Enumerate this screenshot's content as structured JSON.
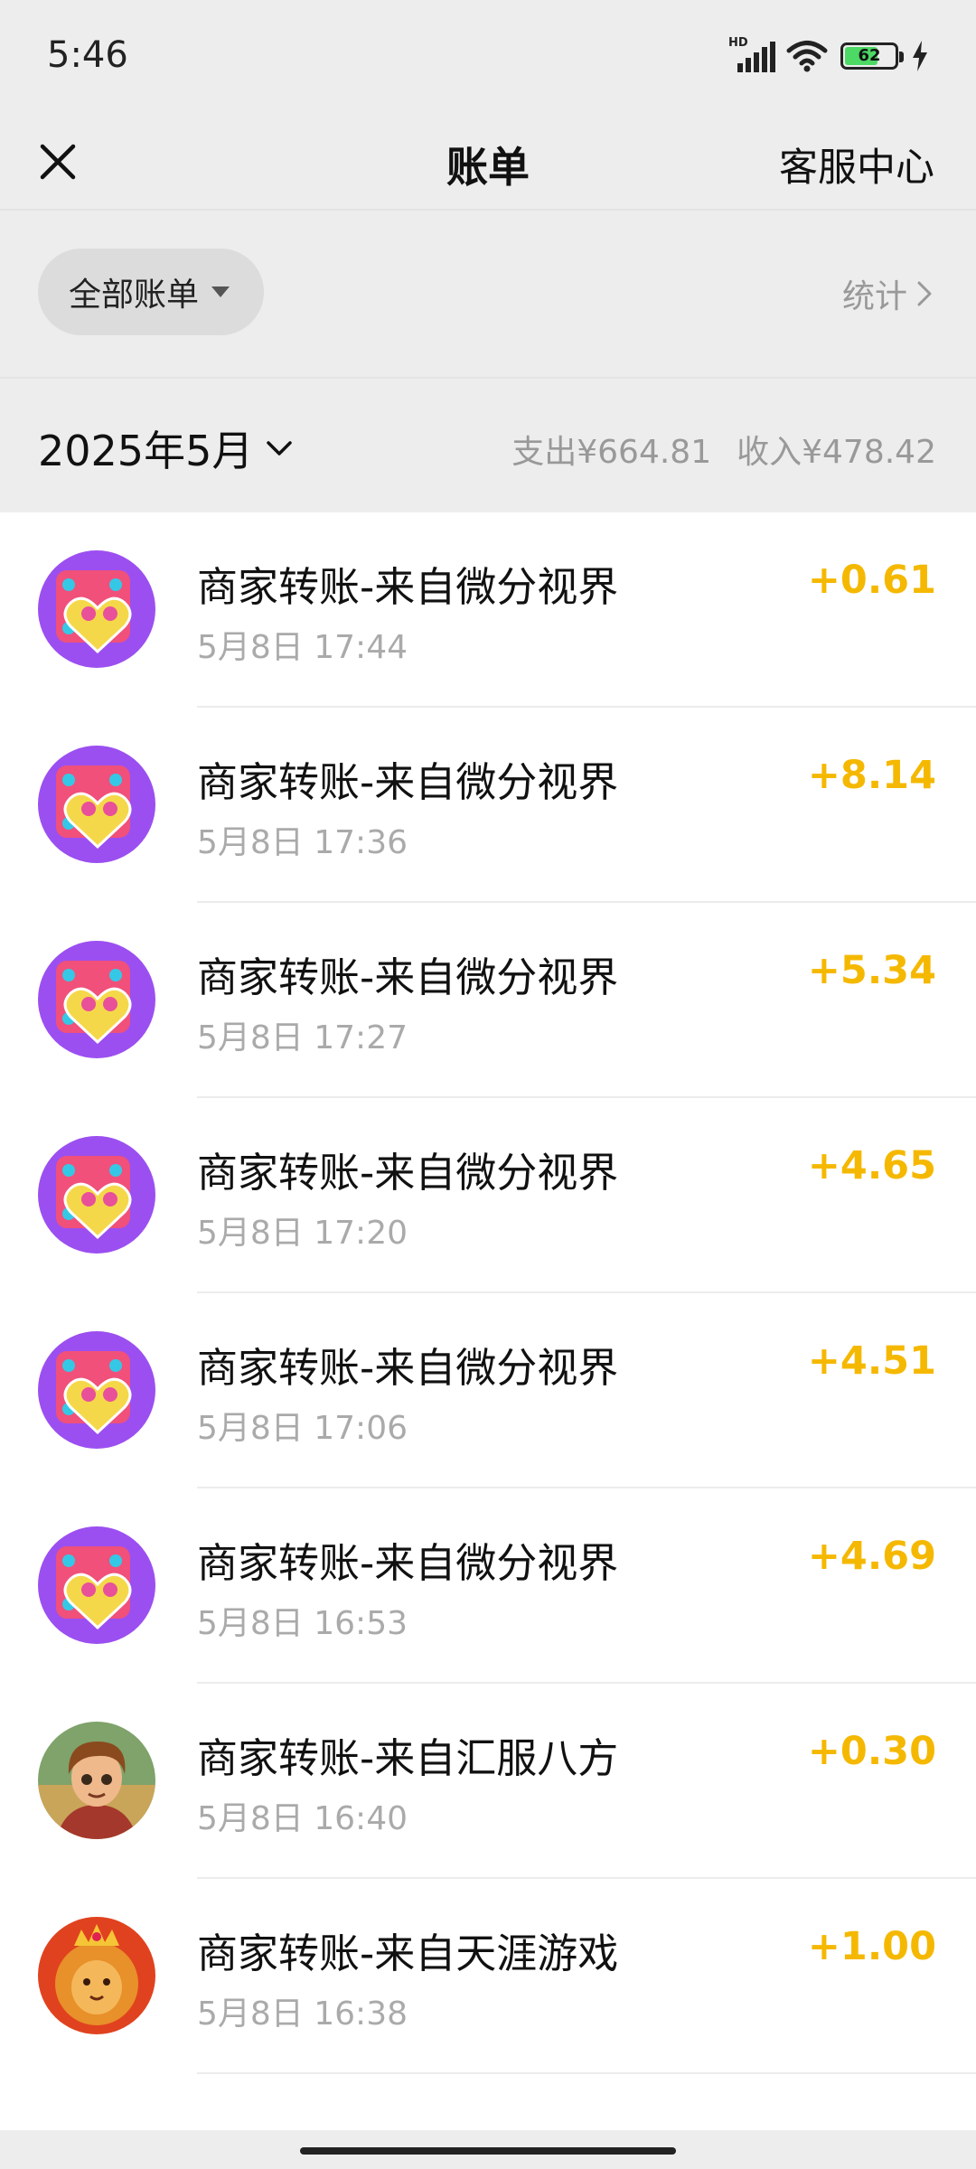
{
  "status_bar": {
    "time": "5:46",
    "network": "HD",
    "battery": "62"
  },
  "nav": {
    "title": "账单",
    "service": "客服中心"
  },
  "filter": {
    "label": "全部账单",
    "stats": "统计"
  },
  "month": {
    "label": "2025年5月",
    "expense": "支出¥664.81",
    "income": "收入¥478.42"
  },
  "transactions": [
    {
      "title": "商家转账-来自微分视界",
      "time": "5月8日 17:44",
      "amount": "+0.61",
      "avatar": "heart-game-icon"
    },
    {
      "title": "商家转账-来自微分视界",
      "time": "5月8日 17:36",
      "amount": "+8.14",
      "avatar": "heart-game-icon"
    },
    {
      "title": "商家转账-来自微分视界",
      "time": "5月8日 17:27",
      "amount": "+5.34",
      "avatar": "heart-game-icon"
    },
    {
      "title": "商家转账-来自微分视界",
      "time": "5月8日 17:20",
      "amount": "+4.65",
      "avatar": "heart-game-icon"
    },
    {
      "title": "商家转账-来自微分视界",
      "time": "5月8日 17:06",
      "amount": "+4.51",
      "avatar": "heart-game-icon"
    },
    {
      "title": "商家转账-来自微分视界",
      "time": "5月8日 16:53",
      "amount": "+4.69",
      "avatar": "heart-game-icon"
    },
    {
      "title": "商家转账-来自汇服八方",
      "time": "5月8日 16:40",
      "amount": "+0.30",
      "avatar": "cartoon-boy-avatar"
    },
    {
      "title": "商家转账-来自天涯游戏",
      "time": "5月8日 16:38",
      "amount": "+1.00",
      "avatar": "lion-king-avatar"
    }
  ],
  "colors": {
    "amount": "#f5b800",
    "background": "#ededed",
    "list_background": "#ffffff"
  }
}
